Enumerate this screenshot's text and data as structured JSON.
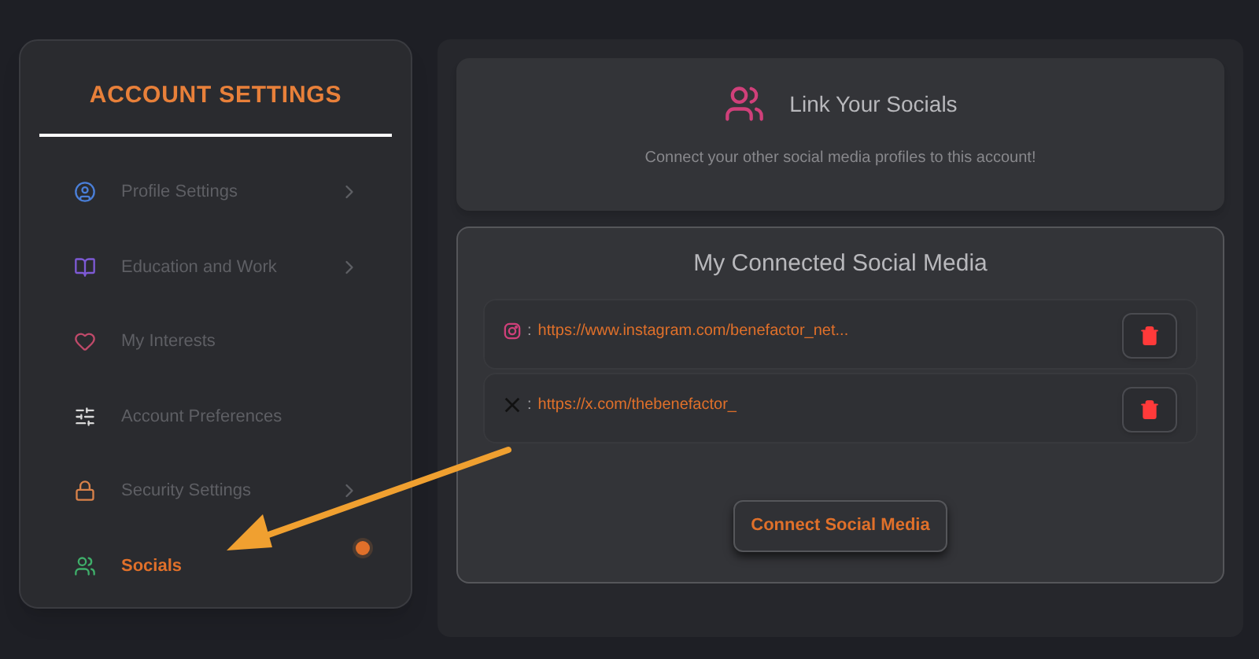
{
  "sidebar": {
    "title": "ACCOUNT SETTINGS",
    "items": [
      {
        "kind": "profile",
        "label": "Profile Settings",
        "color": "#4a7fd8",
        "has_submenu": true,
        "selected": false,
        "dot": false
      },
      {
        "kind": "book",
        "label": "Education and Work",
        "color": "#7e5ad6",
        "has_submenu": true,
        "selected": false,
        "dot": false
      },
      {
        "kind": "heart",
        "label": "My Interests",
        "color": "#c04a6a",
        "has_submenu": false,
        "selected": false,
        "dot": false
      },
      {
        "kind": "sliders",
        "label": "Account Preferences",
        "color": "#d8d8d8",
        "has_submenu": false,
        "selected": false,
        "dot": false
      },
      {
        "kind": "lock",
        "label": "Security Settings",
        "color": "#d9824a",
        "has_submenu": true,
        "selected": false,
        "dot": false
      },
      {
        "kind": "people",
        "label": "Socials",
        "color": "#3fae6a",
        "has_submenu": false,
        "selected": true,
        "dot": true
      }
    ]
  },
  "header": {
    "title": "Link Your Socials",
    "subtitle": "Connect your other social media profiles to this account!"
  },
  "connected": {
    "title": "My Connected Social Media",
    "rows": [
      {
        "kind": "instagram",
        "separator": ":",
        "url": "https://www.instagram.com/benefactor_net..."
      },
      {
        "kind": "x",
        "separator": ":",
        "url": "https://x.com/thebenefactor_"
      }
    ],
    "button": "Connect Social Media"
  }
}
